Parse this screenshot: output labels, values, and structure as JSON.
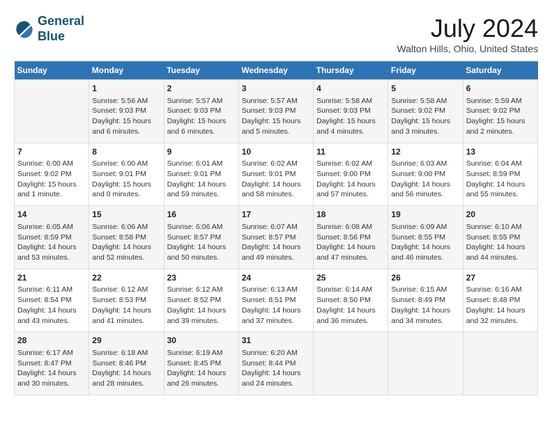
{
  "header": {
    "logo_line1": "General",
    "logo_line2": "Blue",
    "main_title": "July 2024",
    "subtitle": "Walton Hills, Ohio, United States"
  },
  "weekdays": [
    "Sunday",
    "Monday",
    "Tuesday",
    "Wednesday",
    "Thursday",
    "Friday",
    "Saturday"
  ],
  "weeks": [
    [
      {
        "day": "",
        "sunrise": "",
        "sunset": "",
        "daylight": ""
      },
      {
        "day": "1",
        "sunrise": "5:56 AM",
        "sunset": "9:03 PM",
        "daylight": "15 hours and 6 minutes."
      },
      {
        "day": "2",
        "sunrise": "5:57 AM",
        "sunset": "9:03 PM",
        "daylight": "15 hours and 6 minutes."
      },
      {
        "day": "3",
        "sunrise": "5:57 AM",
        "sunset": "9:03 PM",
        "daylight": "15 hours and 5 minutes."
      },
      {
        "day": "4",
        "sunrise": "5:58 AM",
        "sunset": "9:03 PM",
        "daylight": "15 hours and 4 minutes."
      },
      {
        "day": "5",
        "sunrise": "5:58 AM",
        "sunset": "9:02 PM",
        "daylight": "15 hours and 3 minutes."
      },
      {
        "day": "6",
        "sunrise": "5:59 AM",
        "sunset": "9:02 PM",
        "daylight": "15 hours and 2 minutes."
      }
    ],
    [
      {
        "day": "7",
        "sunrise": "6:00 AM",
        "sunset": "9:02 PM",
        "daylight": "15 hours and 1 minute."
      },
      {
        "day": "8",
        "sunrise": "6:00 AM",
        "sunset": "9:01 PM",
        "daylight": "15 hours and 0 minutes."
      },
      {
        "day": "9",
        "sunrise": "6:01 AM",
        "sunset": "9:01 PM",
        "daylight": "14 hours and 59 minutes."
      },
      {
        "day": "10",
        "sunrise": "6:02 AM",
        "sunset": "9:01 PM",
        "daylight": "14 hours and 58 minutes."
      },
      {
        "day": "11",
        "sunrise": "6:02 AM",
        "sunset": "9:00 PM",
        "daylight": "14 hours and 57 minutes."
      },
      {
        "day": "12",
        "sunrise": "6:03 AM",
        "sunset": "9:00 PM",
        "daylight": "14 hours and 56 minutes."
      },
      {
        "day": "13",
        "sunrise": "6:04 AM",
        "sunset": "8:59 PM",
        "daylight": "14 hours and 55 minutes."
      }
    ],
    [
      {
        "day": "14",
        "sunrise": "6:05 AM",
        "sunset": "8:59 PM",
        "daylight": "14 hours and 53 minutes."
      },
      {
        "day": "15",
        "sunrise": "6:06 AM",
        "sunset": "8:58 PM",
        "daylight": "14 hours and 52 minutes."
      },
      {
        "day": "16",
        "sunrise": "6:06 AM",
        "sunset": "8:57 PM",
        "daylight": "14 hours and 50 minutes."
      },
      {
        "day": "17",
        "sunrise": "6:07 AM",
        "sunset": "8:57 PM",
        "daylight": "14 hours and 49 minutes."
      },
      {
        "day": "18",
        "sunrise": "6:08 AM",
        "sunset": "8:56 PM",
        "daylight": "14 hours and 47 minutes."
      },
      {
        "day": "19",
        "sunrise": "6:09 AM",
        "sunset": "8:55 PM",
        "daylight": "14 hours and 46 minutes."
      },
      {
        "day": "20",
        "sunrise": "6:10 AM",
        "sunset": "8:55 PM",
        "daylight": "14 hours and 44 minutes."
      }
    ],
    [
      {
        "day": "21",
        "sunrise": "6:11 AM",
        "sunset": "8:54 PM",
        "daylight": "14 hours and 43 minutes."
      },
      {
        "day": "22",
        "sunrise": "6:12 AM",
        "sunset": "8:53 PM",
        "daylight": "14 hours and 41 minutes."
      },
      {
        "day": "23",
        "sunrise": "6:12 AM",
        "sunset": "8:52 PM",
        "daylight": "14 hours and 39 minutes."
      },
      {
        "day": "24",
        "sunrise": "6:13 AM",
        "sunset": "8:51 PM",
        "daylight": "14 hours and 37 minutes."
      },
      {
        "day": "25",
        "sunrise": "6:14 AM",
        "sunset": "8:50 PM",
        "daylight": "14 hours and 36 minutes."
      },
      {
        "day": "26",
        "sunrise": "6:15 AM",
        "sunset": "8:49 PM",
        "daylight": "14 hours and 34 minutes."
      },
      {
        "day": "27",
        "sunrise": "6:16 AM",
        "sunset": "8:48 PM",
        "daylight": "14 hours and 32 minutes."
      }
    ],
    [
      {
        "day": "28",
        "sunrise": "6:17 AM",
        "sunset": "8:47 PM",
        "daylight": "14 hours and 30 minutes."
      },
      {
        "day": "29",
        "sunrise": "6:18 AM",
        "sunset": "8:46 PM",
        "daylight": "14 hours and 28 minutes."
      },
      {
        "day": "30",
        "sunrise": "6:19 AM",
        "sunset": "8:45 PM",
        "daylight": "14 hours and 26 minutes."
      },
      {
        "day": "31",
        "sunrise": "6:20 AM",
        "sunset": "8:44 PM",
        "daylight": "14 hours and 24 minutes."
      },
      {
        "day": "",
        "sunrise": "",
        "sunset": "",
        "daylight": ""
      },
      {
        "day": "",
        "sunrise": "",
        "sunset": "",
        "daylight": ""
      },
      {
        "day": "",
        "sunrise": "",
        "sunset": "",
        "daylight": ""
      }
    ]
  ]
}
